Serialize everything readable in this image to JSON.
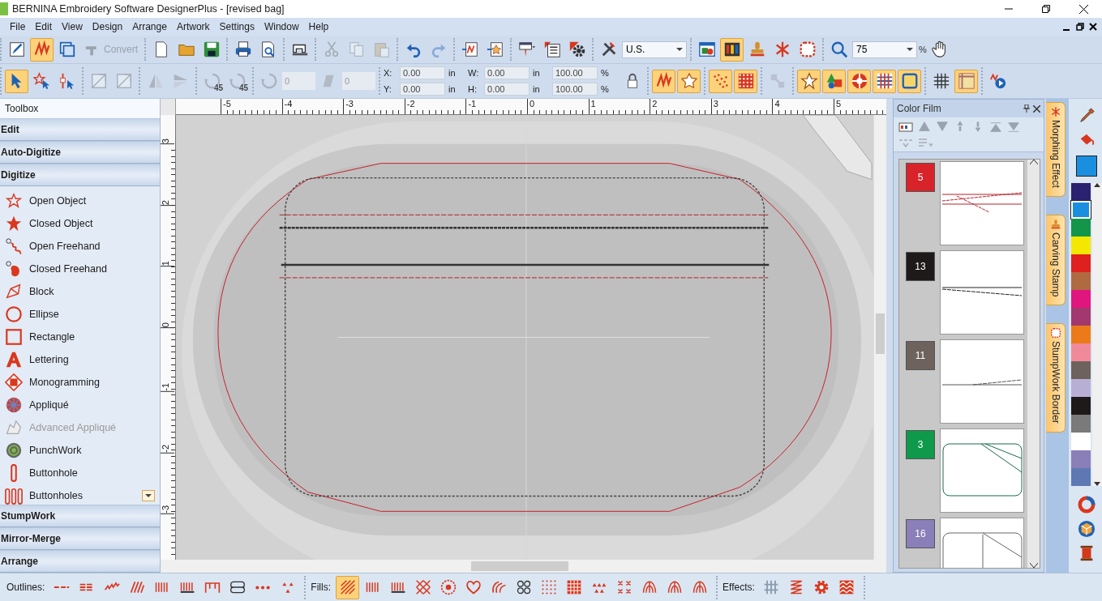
{
  "window": {
    "title": "BERNINA Embroidery Software DesignerPlus - [revised bag]"
  },
  "menu": [
    "File",
    "Edit",
    "View",
    "Design",
    "Arrange",
    "Artwork",
    "Settings",
    "Window",
    "Help"
  ],
  "toolbar_1": [
    [
      {
        "kind": "icon",
        "selected": false,
        "disabled": false
      },
      {
        "kind": "icon",
        "selected": true,
        "disabled": false
      },
      {
        "kind": "icon",
        "selected": false,
        "disabled": false
      },
      {
        "kind": "button",
        "label": "Convert",
        "disabled": true
      }
    ],
    [
      {
        "kind": "icon",
        "selected": false,
        "disabled": false
      },
      {
        "kind": "icon",
        "selected": false,
        "disabled": false
      },
      {
        "kind": "icon",
        "selected": false,
        "disabled": false
      }
    ],
    [
      {
        "kind": "icon",
        "selected": false,
        "disabled": false
      },
      {
        "kind": "icon",
        "selected": false,
        "disabled": false
      }
    ],
    [
      {
        "kind": "icon",
        "selected": false,
        "disabled": false
      }
    ],
    [
      {
        "kind": "icon",
        "selected": false,
        "disabled": true
      },
      {
        "kind": "icon",
        "selected": false,
        "disabled": true
      },
      {
        "kind": "icon",
        "selected": false,
        "disabled": true
      }
    ],
    [
      {
        "kind": "icon",
        "selected": false,
        "disabled": false
      },
      {
        "kind": "icon",
        "selected": false,
        "disabled": true
      }
    ],
    [
      {
        "kind": "icon",
        "selected": false,
        "disabled": false
      },
      {
        "kind": "icon",
        "selected": false,
        "disabled": false
      }
    ],
    [
      {
        "kind": "icon",
        "selected": false,
        "disabled": false
      },
      {
        "kind": "icon",
        "selected": false,
        "disabled": false
      },
      {
        "kind": "icon",
        "selected": false,
        "disabled": false
      }
    ],
    [
      {
        "kind": "icon",
        "selected": false,
        "disabled": false
      },
      {
        "kind": "select",
        "value": "U.S."
      }
    ],
    [
      {
        "kind": "icon",
        "selected": false,
        "disabled": false
      },
      {
        "kind": "icon",
        "selected": true,
        "disabled": false
      },
      {
        "kind": "icon",
        "selected": false,
        "disabled": false
      },
      {
        "kind": "icon",
        "selected": false,
        "disabled": false
      },
      {
        "kind": "icon",
        "selected": false,
        "disabled": false
      }
    ],
    [
      {
        "kind": "icon",
        "selected": false,
        "disabled": false
      },
      {
        "kind": "select",
        "value": "75"
      },
      {
        "kind": "label",
        "text": "%"
      },
      {
        "kind": "icon",
        "selected": false,
        "disabled": false
      }
    ]
  ],
  "toolbar_2": [
    [
      {
        "kind": "icon",
        "selected": true,
        "disabled": false
      },
      {
        "kind": "icon",
        "selected": false,
        "disabled": false
      },
      {
        "kind": "icon",
        "selected": false,
        "disabled": false
      }
    ],
    [
      {
        "kind": "icon",
        "selected": false,
        "disabled": true
      },
      {
        "kind": "icon",
        "selected": false,
        "disabled": true
      }
    ],
    [
      {
        "kind": "icon",
        "selected": false,
        "disabled": true
      },
      {
        "kind": "icon",
        "selected": false,
        "disabled": true
      }
    ],
    [
      {
        "kind": "icon",
        "selected": false,
        "disabled": true,
        "caption": "45"
      },
      {
        "kind": "icon",
        "selected": false,
        "disabled": true,
        "caption": "45"
      }
    ],
    [
      {
        "kind": "icon",
        "selected": false,
        "disabled": true
      },
      {
        "kind": "spin",
        "value": "0",
        "disabled": true
      },
      {
        "kind": "icon",
        "selected": false,
        "disabled": true
      },
      {
        "kind": "spin",
        "value": "0",
        "disabled": true
      }
    ],
    [
      {
        "kind": "fields",
        "rows": [
          {
            "label": "X:",
            "value": "0.00",
            "unit": "in"
          },
          {
            "label": "Y:",
            "value": "0.00",
            "unit": "in"
          }
        ]
      },
      {
        "kind": "fields",
        "rows": [
          {
            "label": "W:",
            "value": "0.00",
            "unit": "in"
          },
          {
            "label": "H:",
            "value": "0.00",
            "unit": "in"
          }
        ]
      },
      {
        "kind": "fields",
        "rows": [
          {
            "value": "100.00",
            "unit": "%"
          },
          {
            "value": "100.00",
            "unit": "%"
          }
        ]
      },
      {
        "kind": "icon",
        "selected": false,
        "disabled": false
      }
    ],
    [
      {
        "kind": "icon",
        "selected": true,
        "disabled": false
      },
      {
        "kind": "icon",
        "selected": true,
        "disabled": false
      }
    ],
    [
      {
        "kind": "icon",
        "selected": true,
        "disabled": false
      },
      {
        "kind": "icon",
        "selected": true,
        "disabled": false
      }
    ],
    [
      {
        "kind": "icon",
        "selected": false,
        "disabled": true
      }
    ],
    [
      {
        "kind": "icon",
        "selected": true,
        "disabled": false
      },
      {
        "kind": "icon",
        "selected": true,
        "disabled": false
      },
      {
        "kind": "icon",
        "selected": true,
        "disabled": false
      },
      {
        "kind": "icon",
        "selected": true,
        "disabled": false
      },
      {
        "kind": "icon",
        "selected": true,
        "disabled": false
      }
    ],
    [
      {
        "kind": "icon",
        "selected": false,
        "disabled": false
      },
      {
        "kind": "icon",
        "selected": true,
        "disabled": false
      }
    ],
    [
      {
        "kind": "icon",
        "selected": false,
        "disabled": false
      }
    ]
  ],
  "toolbox": {
    "title": "Toolbox",
    "sections": [
      {
        "label": "Edit"
      },
      {
        "label": "Auto-Digitize"
      },
      {
        "label": "Digitize",
        "items": [
          {
            "label": "Open Object",
            "disabled": false
          },
          {
            "label": "Closed Object",
            "disabled": false
          },
          {
            "label": "Open Freehand",
            "disabled": false
          },
          {
            "label": "Closed Freehand",
            "disabled": false
          },
          {
            "label": "Block",
            "disabled": false
          },
          {
            "label": "Ellipse",
            "disabled": false
          },
          {
            "label": "Rectangle",
            "disabled": false
          },
          {
            "label": "Lettering",
            "disabled": false
          },
          {
            "label": "Monogramming",
            "disabled": false
          },
          {
            "label": "Appliqué",
            "disabled": false
          },
          {
            "label": "Advanced Appliqué",
            "disabled": true
          },
          {
            "label": "PunchWork",
            "disabled": false
          },
          {
            "label": "Buttonhole",
            "disabled": false
          },
          {
            "label": "Buttonholes",
            "disabled": false
          }
        ]
      },
      {
        "label": "StumpWork"
      },
      {
        "label": "Mirror-Merge"
      },
      {
        "label": "Arrange"
      }
    ]
  },
  "ruler": {
    "horizontal": [
      "-5",
      "-4",
      "-3",
      "-2",
      "-1",
      "0",
      "1",
      "2",
      "3",
      "4",
      "5"
    ],
    "vertical": [
      "3",
      "2",
      "1",
      "0",
      "-1",
      "-2",
      "-3"
    ]
  },
  "color_film": {
    "title": "Color Film",
    "items": [
      {
        "number": "5",
        "color": "#d8232a"
      },
      {
        "number": "13",
        "color": "#1e1a1a"
      },
      {
        "number": "11",
        "color": "#6e625d"
      },
      {
        "number": "3",
        "color": "#0e9a4a"
      },
      {
        "number": "16",
        "color": "#8a7fb8"
      }
    ]
  },
  "side_tabs": [
    {
      "label": "Morphing Effect"
    },
    {
      "label": "Carving Stamp"
    },
    {
      "label": "StumpWork Border"
    }
  ],
  "palette": {
    "swatches": [
      {
        "color": "#2a2170",
        "selected": false
      },
      {
        "color": "#1a8fe0",
        "selected": true
      },
      {
        "color": "#14964a",
        "selected": false
      },
      {
        "color": "#f5e800",
        "selected": false
      },
      {
        "color": "#e0201e",
        "selected": false
      },
      {
        "color": "#b06a42",
        "selected": false
      },
      {
        "color": "#e0167e",
        "selected": false
      },
      {
        "color": "#a2386e",
        "selected": false
      },
      {
        "color": "#ec7a18",
        "selected": false
      },
      {
        "color": "#f08a9a",
        "selected": false
      },
      {
        "color": "#6e625d",
        "selected": false
      },
      {
        "color": "#b8b0d4",
        "selected": false
      },
      {
        "color": "#1e1a1a",
        "selected": false
      },
      {
        "color": "#7a7a7a",
        "selected": false
      },
      {
        "color": "#ffffff",
        "selected": false
      },
      {
        "color": "#8a7fb8",
        "selected": false
      },
      {
        "color": "#5e78b4",
        "selected": false
      }
    ]
  },
  "bottom_bar": [
    {
      "label": "Outlines:",
      "buttons": [
        {
          "selected": false
        },
        {
          "selected": false
        },
        {
          "selected": false
        },
        {
          "selected": false
        },
        {
          "selected": false
        },
        {
          "selected": false
        },
        {
          "selected": false
        },
        {
          "selected": false
        },
        {
          "selected": false
        },
        {
          "selected": false
        }
      ]
    },
    {
      "label": "Fills:",
      "buttons": [
        {
          "selected": true
        },
        {
          "selected": false
        },
        {
          "selected": false
        },
        {
          "selected": false
        },
        {
          "selected": false
        },
        {
          "selected": false
        },
        {
          "selected": false
        },
        {
          "selected": false
        },
        {
          "selected": false
        },
        {
          "selected": false
        },
        {
          "selected": false
        },
        {
          "selected": false
        },
        {
          "selected": false
        },
        {
          "selected": false
        },
        {
          "selected": false
        }
      ]
    },
    {
      "label": "Effects:",
      "buttons": [
        {
          "selected": false
        },
        {
          "selected": false
        },
        {
          "selected": false
        },
        {
          "selected": false
        }
      ]
    }
  ]
}
